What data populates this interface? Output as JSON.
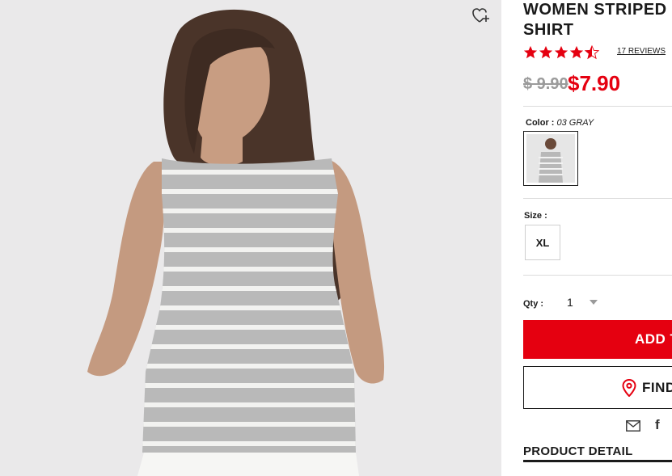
{
  "product": {
    "title_line1": "WOMEN STRIPED S",
    "title_line2": "SHIRT",
    "rating": 4.5,
    "reviews_label": "17 REVIEWS",
    "old_price": "$ 9.90",
    "price": "$7.90"
  },
  "color": {
    "label": "Color :",
    "value": "03 GRAY"
  },
  "size": {
    "label": "Size :",
    "options": [
      "XL"
    ]
  },
  "quantity": {
    "label": "Qty :",
    "value": "1"
  },
  "actions": {
    "add_label": "ADD T",
    "find_label": "FIND"
  },
  "share": {
    "facebook_glyph": "f"
  },
  "detail_tab": "PRODUCT DETAIL",
  "icons": [
    "wishlist-heart-plus-icon",
    "star-icon",
    "chevron-down-icon",
    "location-pin-icon",
    "mail-icon",
    "facebook-icon"
  ],
  "colors": {
    "accent": "#e50010",
    "text": "#1b1b1b",
    "muted": "#9b9b9b",
    "photo_bg": "#eae9ea"
  }
}
